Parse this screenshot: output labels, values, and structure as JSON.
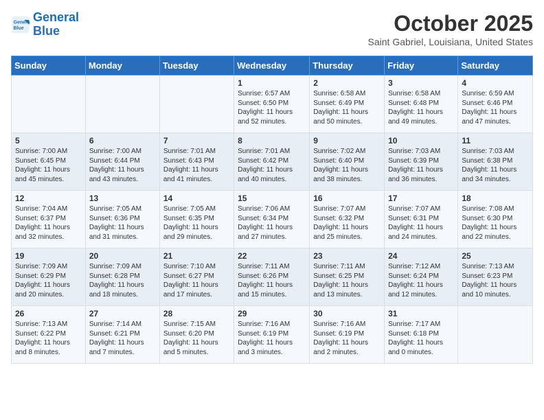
{
  "logo": {
    "line1": "General",
    "line2": "Blue"
  },
  "title": "October 2025",
  "subtitle": "Saint Gabriel, Louisiana, United States",
  "days_header": [
    "Sunday",
    "Monday",
    "Tuesday",
    "Wednesday",
    "Thursday",
    "Friday",
    "Saturday"
  ],
  "weeks": [
    [
      {
        "day": "",
        "info": ""
      },
      {
        "day": "",
        "info": ""
      },
      {
        "day": "",
        "info": ""
      },
      {
        "day": "1",
        "info": "Sunrise: 6:57 AM\nSunset: 6:50 PM\nDaylight: 11 hours and 52 minutes."
      },
      {
        "day": "2",
        "info": "Sunrise: 6:58 AM\nSunset: 6:49 PM\nDaylight: 11 hours and 50 minutes."
      },
      {
        "day": "3",
        "info": "Sunrise: 6:58 AM\nSunset: 6:48 PM\nDaylight: 11 hours and 49 minutes."
      },
      {
        "day": "4",
        "info": "Sunrise: 6:59 AM\nSunset: 6:46 PM\nDaylight: 11 hours and 47 minutes."
      }
    ],
    [
      {
        "day": "5",
        "info": "Sunrise: 7:00 AM\nSunset: 6:45 PM\nDaylight: 11 hours and 45 minutes."
      },
      {
        "day": "6",
        "info": "Sunrise: 7:00 AM\nSunset: 6:44 PM\nDaylight: 11 hours and 43 minutes."
      },
      {
        "day": "7",
        "info": "Sunrise: 7:01 AM\nSunset: 6:43 PM\nDaylight: 11 hours and 41 minutes."
      },
      {
        "day": "8",
        "info": "Sunrise: 7:01 AM\nSunset: 6:42 PM\nDaylight: 11 hours and 40 minutes."
      },
      {
        "day": "9",
        "info": "Sunrise: 7:02 AM\nSunset: 6:40 PM\nDaylight: 11 hours and 38 minutes."
      },
      {
        "day": "10",
        "info": "Sunrise: 7:03 AM\nSunset: 6:39 PM\nDaylight: 11 hours and 36 minutes."
      },
      {
        "day": "11",
        "info": "Sunrise: 7:03 AM\nSunset: 6:38 PM\nDaylight: 11 hours and 34 minutes."
      }
    ],
    [
      {
        "day": "12",
        "info": "Sunrise: 7:04 AM\nSunset: 6:37 PM\nDaylight: 11 hours and 32 minutes."
      },
      {
        "day": "13",
        "info": "Sunrise: 7:05 AM\nSunset: 6:36 PM\nDaylight: 11 hours and 31 minutes."
      },
      {
        "day": "14",
        "info": "Sunrise: 7:05 AM\nSunset: 6:35 PM\nDaylight: 11 hours and 29 minutes."
      },
      {
        "day": "15",
        "info": "Sunrise: 7:06 AM\nSunset: 6:34 PM\nDaylight: 11 hours and 27 minutes."
      },
      {
        "day": "16",
        "info": "Sunrise: 7:07 AM\nSunset: 6:32 PM\nDaylight: 11 hours and 25 minutes."
      },
      {
        "day": "17",
        "info": "Sunrise: 7:07 AM\nSunset: 6:31 PM\nDaylight: 11 hours and 24 minutes."
      },
      {
        "day": "18",
        "info": "Sunrise: 7:08 AM\nSunset: 6:30 PM\nDaylight: 11 hours and 22 minutes."
      }
    ],
    [
      {
        "day": "19",
        "info": "Sunrise: 7:09 AM\nSunset: 6:29 PM\nDaylight: 11 hours and 20 minutes."
      },
      {
        "day": "20",
        "info": "Sunrise: 7:09 AM\nSunset: 6:28 PM\nDaylight: 11 hours and 18 minutes."
      },
      {
        "day": "21",
        "info": "Sunrise: 7:10 AM\nSunset: 6:27 PM\nDaylight: 11 hours and 17 minutes."
      },
      {
        "day": "22",
        "info": "Sunrise: 7:11 AM\nSunset: 6:26 PM\nDaylight: 11 hours and 15 minutes."
      },
      {
        "day": "23",
        "info": "Sunrise: 7:11 AM\nSunset: 6:25 PM\nDaylight: 11 hours and 13 minutes."
      },
      {
        "day": "24",
        "info": "Sunrise: 7:12 AM\nSunset: 6:24 PM\nDaylight: 11 hours and 12 minutes."
      },
      {
        "day": "25",
        "info": "Sunrise: 7:13 AM\nSunset: 6:23 PM\nDaylight: 11 hours and 10 minutes."
      }
    ],
    [
      {
        "day": "26",
        "info": "Sunrise: 7:13 AM\nSunset: 6:22 PM\nDaylight: 11 hours and 8 minutes."
      },
      {
        "day": "27",
        "info": "Sunrise: 7:14 AM\nSunset: 6:21 PM\nDaylight: 11 hours and 7 minutes."
      },
      {
        "day": "28",
        "info": "Sunrise: 7:15 AM\nSunset: 6:20 PM\nDaylight: 11 hours and 5 minutes."
      },
      {
        "day": "29",
        "info": "Sunrise: 7:16 AM\nSunset: 6:19 PM\nDaylight: 11 hours and 3 minutes."
      },
      {
        "day": "30",
        "info": "Sunrise: 7:16 AM\nSunset: 6:19 PM\nDaylight: 11 hours and 2 minutes."
      },
      {
        "day": "31",
        "info": "Sunrise: 7:17 AM\nSunset: 6:18 PM\nDaylight: 11 hours and 0 minutes."
      },
      {
        "day": "",
        "info": ""
      }
    ]
  ]
}
